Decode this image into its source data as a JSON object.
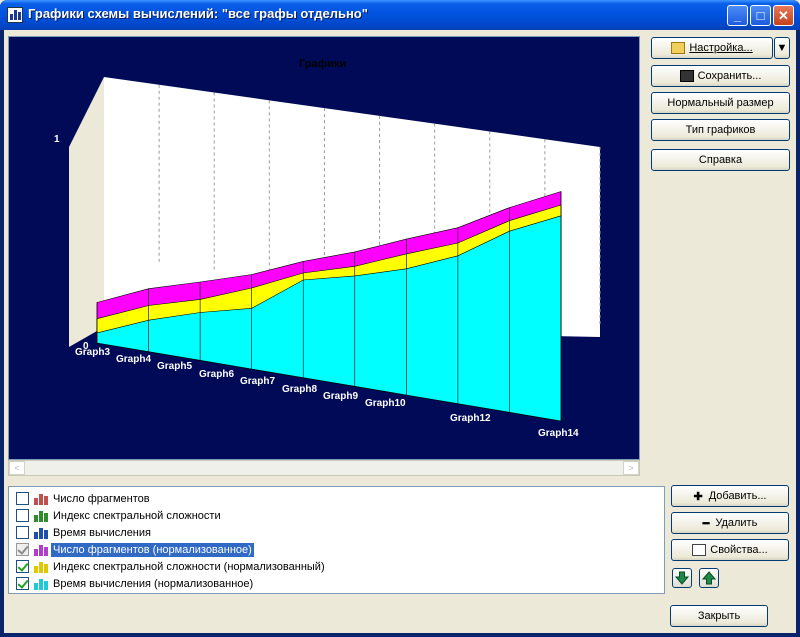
{
  "window": {
    "title": "Графики схемы вычислений: \"все графы отдельно\""
  },
  "chart": {
    "title": "Графики",
    "y_ticks": [
      "1",
      "0"
    ],
    "x_labels": [
      "Graph3",
      "Graph4",
      "Graph5",
      "Graph6",
      "Graph7",
      "Graph8",
      "Graph9",
      "Graph10",
      "Graph12",
      "Graph14"
    ]
  },
  "chart_data": {
    "type": "area",
    "title": "Графики",
    "categories": [
      "Graph3",
      "Graph4",
      "Graph5",
      "Graph6",
      "Graph7",
      "Graph8",
      "Graph9",
      "Graph10",
      "Graph12",
      "Graph14"
    ],
    "ylim": [
      0,
      1
    ],
    "series": [
      {
        "name": "Время вычисления (нормализованное)",
        "values": [
          0.05,
          0.15,
          0.22,
          0.27,
          0.42,
          0.46,
          0.51,
          0.58,
          0.69,
          0.76
        ]
      },
      {
        "name": "Индекс спектральной сложности (нормализованный)",
        "values": [
          0.12,
          0.22,
          0.28,
          0.36,
          0.45,
          0.5,
          0.57,
          0.63,
          0.73,
          0.8
        ]
      },
      {
        "name": "Число фрагментов (нормализованное)",
        "values": [
          0.2,
          0.3,
          0.36,
          0.42,
          0.5,
          0.56,
          0.63,
          0.69,
          0.78,
          0.85
        ]
      }
    ],
    "colors": [
      "#00ffff",
      "#ffff00",
      "#ff00ff"
    ],
    "grid": true
  },
  "buttons": {
    "settings": "Настройка...",
    "save": "Сохранить...",
    "normal_size": "Нормальный размер",
    "chart_type": "Тип графиков",
    "help": "Справка",
    "add": "Добавить...",
    "remove": "Удалить",
    "properties": "Свойства...",
    "close": "Закрыть"
  },
  "series_list": [
    {
      "label": "Число фрагментов",
      "checked": false,
      "color": "#c0504d"
    },
    {
      "label": "Индекс спектральной сложности",
      "checked": false,
      "color": "#2e8b2e"
    },
    {
      "label": "Время вычисления",
      "checked": false,
      "color": "#1f4fa8"
    },
    {
      "label": "Число фрагментов (нормализованное)",
      "checked": true,
      "selected": true,
      "color": "#b040c8"
    },
    {
      "label": "Индекс спектральной сложности (нормализованный)",
      "checked": true,
      "color": "#e0c800"
    },
    {
      "label": "Время вычисления (нормализованное)",
      "checked": true,
      "color": "#20c8d8"
    }
  ]
}
